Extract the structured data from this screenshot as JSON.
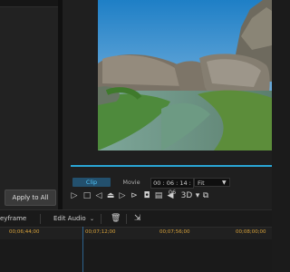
{
  "left_panel": {
    "apply_all_label": "Apply to All"
  },
  "preview": {
    "modes": {
      "clip": "Clip",
      "movie": "Movie"
    },
    "timecode": "00 : 06 : 14 : 06",
    "fit_value": "Fit",
    "view_3d_label": "3D"
  },
  "toolbar": {
    "keyframe_label": "eyframe",
    "edit_audio_label": "Edit Audio"
  },
  "ruler": {
    "ticks": [
      "00;06;44;00",
      "00;07;12;00",
      "00;07;56;00",
      "00;08;00;00"
    ]
  },
  "colors": {
    "accent": "#2aa6d6",
    "tick_text": "#d8a23a"
  }
}
